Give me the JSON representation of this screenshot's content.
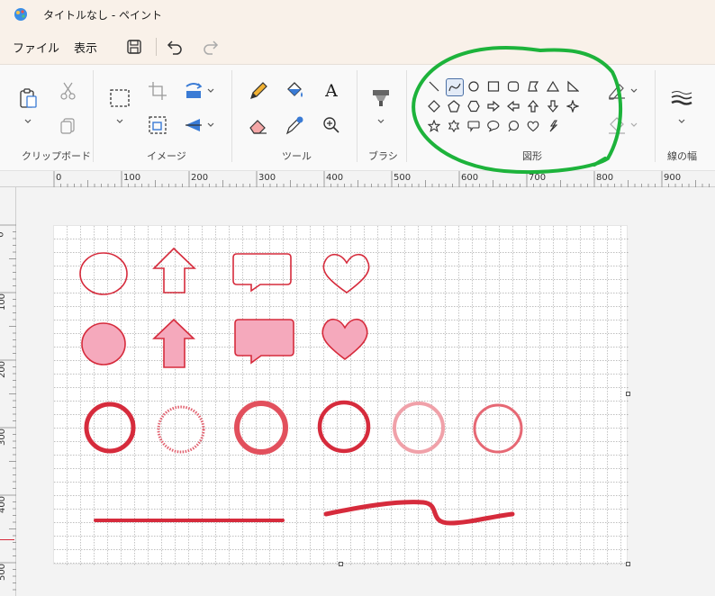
{
  "window": {
    "title": "タイトルなし - ペイント"
  },
  "menu": {
    "file": "ファイル",
    "view": "表示"
  },
  "ribbon": {
    "clipboard_label": "クリップボード",
    "image_label": "イメージ",
    "tools_label": "ツール",
    "brush_label": "ブラシ",
    "shapes_label": "図形",
    "stroke_label": "線の幅"
  },
  "ruler_h": [
    "0",
    "100",
    "200",
    "300",
    "400",
    "500",
    "600",
    "700",
    "800",
    "900"
  ],
  "ruler_v": [
    "0",
    "100",
    "200",
    "300",
    "400",
    "500"
  ],
  "colors": {
    "shape_red": "#d62b3c",
    "fill_pink": "#f5a9bc",
    "annotation_green": "#1db33b"
  }
}
